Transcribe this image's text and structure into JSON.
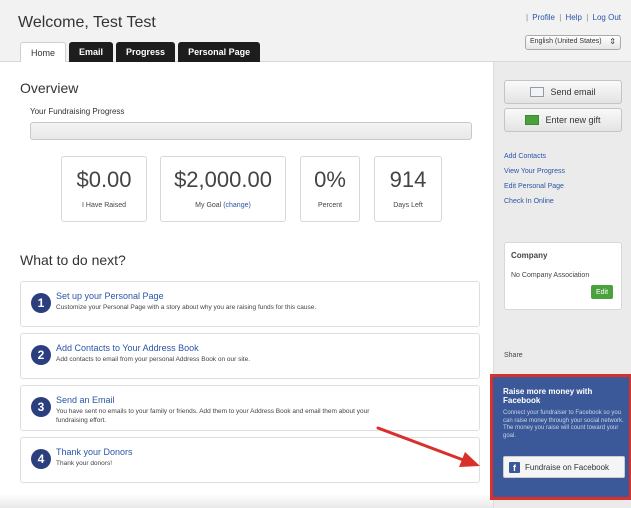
{
  "header": {
    "welcome": "Welcome, Test Test",
    "links": [
      "Profile",
      "Help",
      "Log Out"
    ],
    "language": "English (United States)"
  },
  "tabs": [
    {
      "label": "Home",
      "active": true
    },
    {
      "label": "Email",
      "active": false
    },
    {
      "label": "Progress",
      "active": false
    },
    {
      "label": "Personal Page",
      "active": false
    }
  ],
  "overview": {
    "title": "Overview",
    "progress_label": "Your Fundraising Progress",
    "progress_percent": 0,
    "stats": [
      {
        "value": "$0.00",
        "label": "I Have Raised"
      },
      {
        "value": "$2,000.00",
        "label": "My Goal",
        "link": "(change)"
      },
      {
        "value": "0%",
        "label": "Percent"
      },
      {
        "value": "914",
        "label": "Days Left"
      }
    ]
  },
  "next": {
    "title": "What to do next?",
    "steps": [
      {
        "num": "1",
        "title": "Set up your Personal Page",
        "desc": "Customize your Personal Page with a story about why you are raising funds for this cause."
      },
      {
        "num": "2",
        "title": "Add Contacts to Your Address Book",
        "desc": "Add contacts to email from your personal Address Book on our site."
      },
      {
        "num": "3",
        "title": "Send an Email",
        "desc": "You have sent no emails to your family or friends. Add them to your Address Book and email them about your fundraising effort."
      },
      {
        "num": "4",
        "title": "Thank your Donors",
        "desc": "Thank your donors!"
      }
    ]
  },
  "sidebar": {
    "send_email": "Send email",
    "enter_gift": "Enter new gift",
    "links": [
      "Add Contacts",
      "View Your Progress",
      "Edit Personal Page",
      "Check In Online"
    ],
    "company_title": "Company",
    "company_name": "No Company Association",
    "company_edit": "Edit",
    "share": "Share",
    "fb_title": "Raise more money with Facebook",
    "fb_desc": "Connect your fundraiser to Facebook so you can raise money through your social network. The money you raise will count toward your goal.",
    "fb_button": "Fundraise on Facebook"
  },
  "colors": {
    "facebook_blue": "#3b5998",
    "highlight_red": "#d9302c",
    "accent_green": "#4aa13d",
    "link_blue": "#2956a6"
  }
}
